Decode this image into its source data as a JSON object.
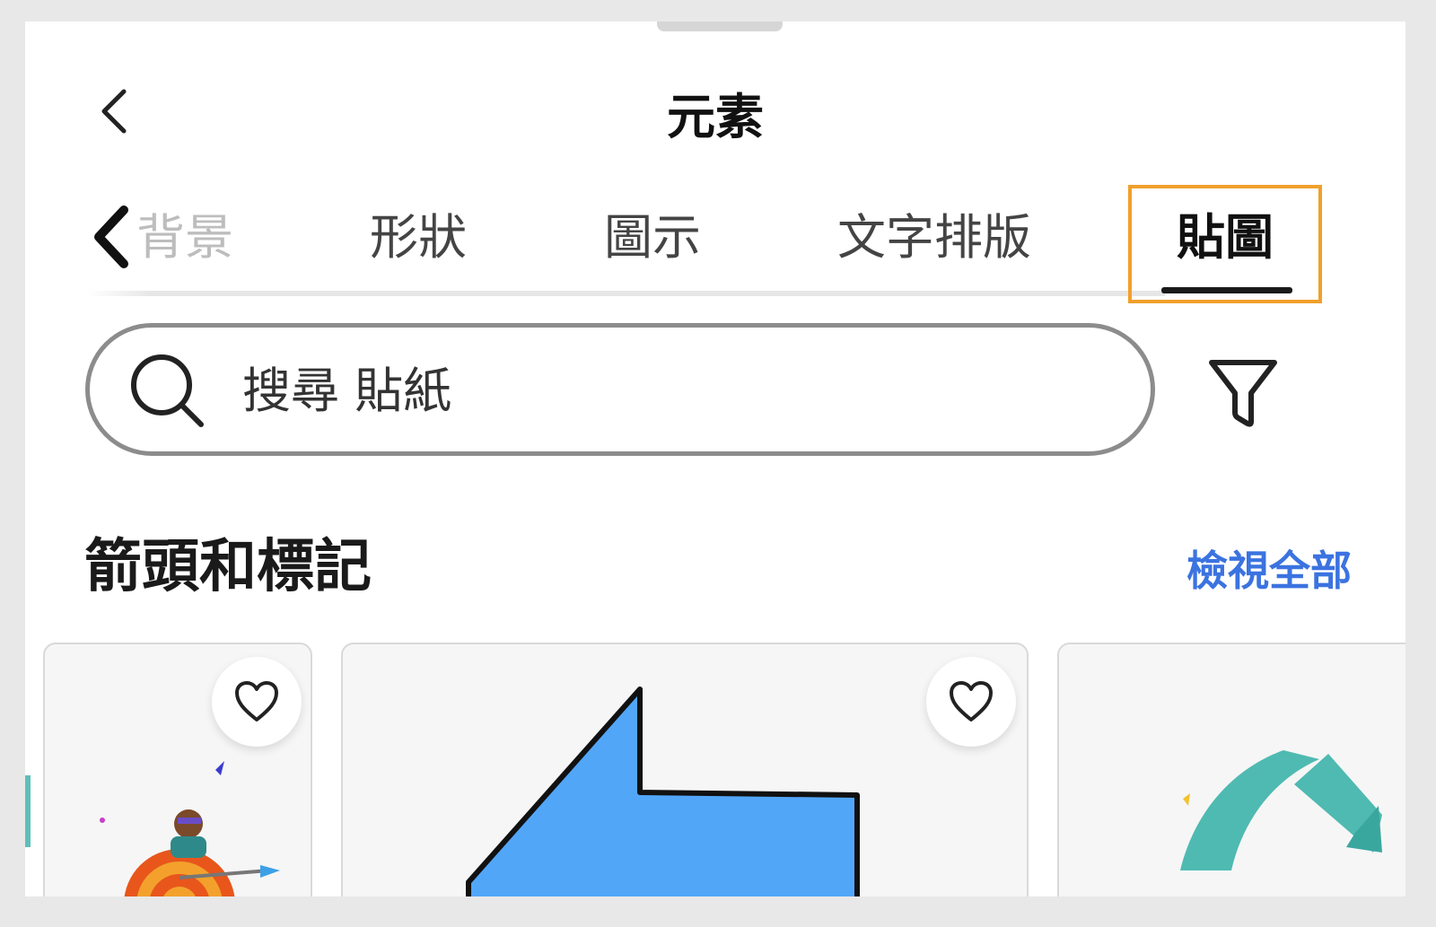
{
  "header": {
    "title": "元素",
    "back_icon": "chevron-left-icon"
  },
  "tabs": {
    "items": [
      {
        "label": "背景",
        "state": "partially-visible"
      },
      {
        "label": "形狀",
        "state": "normal"
      },
      {
        "label": "圖示",
        "state": "normal"
      },
      {
        "label": "文字排版",
        "state": "normal"
      },
      {
        "label": "貼圖",
        "state": "active"
      }
    ],
    "scroll_left_icon": "chevron-left-icon",
    "active_index": 4,
    "highlight_color": "#f0a02c"
  },
  "search": {
    "placeholder": "搜尋 貼紙",
    "icon": "search-icon",
    "filter_icon": "filter-icon"
  },
  "section": {
    "title": "箭頭和標記",
    "view_all": "檢視全部",
    "link_color": "#3b73e0"
  },
  "cards": [
    {
      "art": "target-with-arrow-sticker",
      "favorite_icon": "heart-icon"
    },
    {
      "art": "blue-arrow-sticker",
      "favorite_icon": "heart-icon"
    },
    {
      "art": "teal-curved-arrow-sticker"
    }
  ]
}
